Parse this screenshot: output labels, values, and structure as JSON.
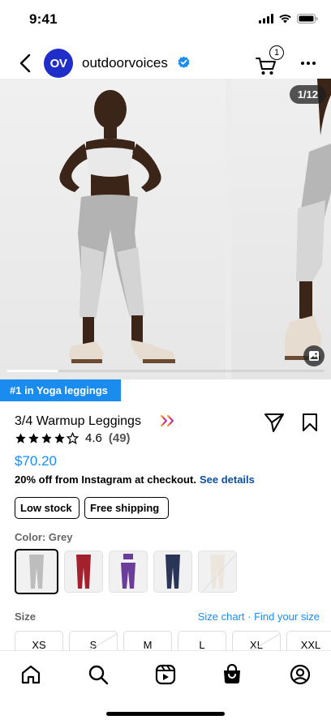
{
  "status": {
    "time": "9:41"
  },
  "header": {
    "brand_initials": "OV",
    "brand_name": "outdoorvoices",
    "cart_count": "1"
  },
  "carousel": {
    "page_counter": "1/12"
  },
  "product": {
    "rank_badge": "#1 in Yoga leggings",
    "title": "3/4 Warmup Leggings",
    "rating": "4.6",
    "rating_value": 4.6,
    "review_count": "(49)",
    "price": "$70.20",
    "promo_text": "20% off from Instagram at checkout.",
    "promo_link": "See details",
    "tags": [
      "Low stock",
      "Free shipping"
    ]
  },
  "color": {
    "label": "Color: Grey",
    "swatches": [
      {
        "name": "Grey",
        "hex": "#bdbdbd",
        "selected": true
      },
      {
        "name": "Red",
        "hex": "#a3212d"
      },
      {
        "name": "Purple",
        "hex": "#6a3d9a"
      },
      {
        "name": "Navy",
        "hex": "#2a3558"
      },
      {
        "name": "Cream",
        "hex": "#ece6dc",
        "unavailable": true
      }
    ]
  },
  "size": {
    "label": "Size",
    "links": "Size chart · Find your size",
    "options": [
      "XS",
      "S",
      "M",
      "L",
      "XL",
      "XXL"
    ]
  },
  "colors": {
    "accent": "#1a8cf0",
    "link_dark": "#0b4f9e",
    "brand": "#1f2ec9"
  }
}
